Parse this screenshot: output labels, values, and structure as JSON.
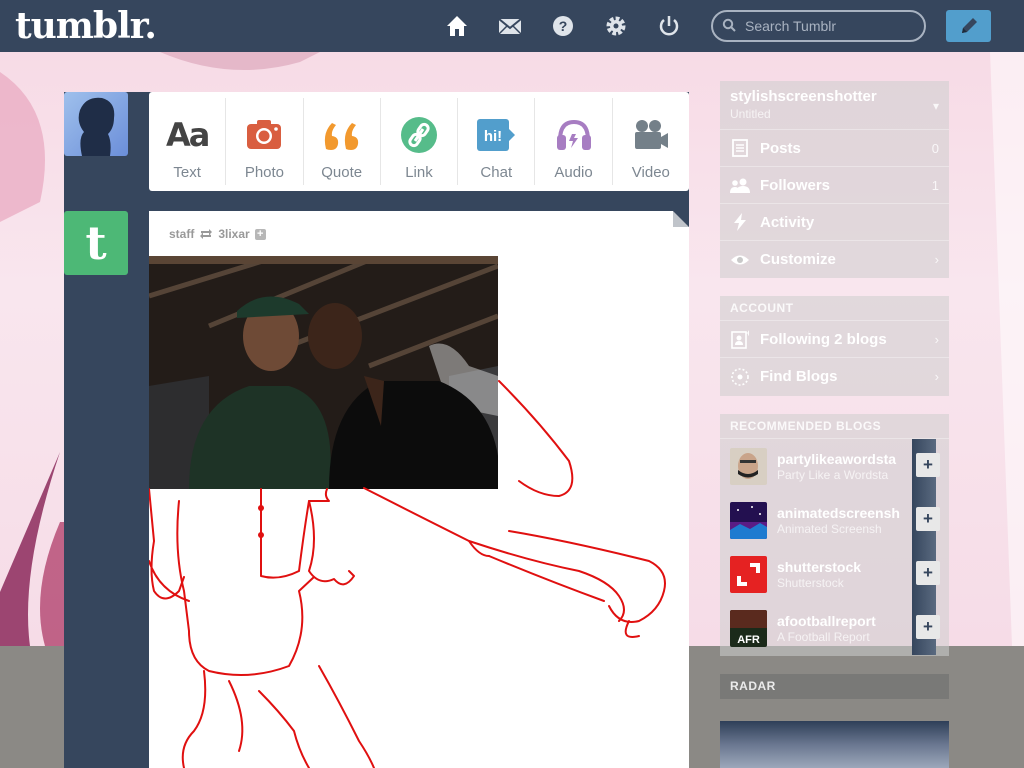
{
  "header": {
    "logo": "tumblr.",
    "search_placeholder": "Search Tumblr",
    "icons": [
      "home-icon",
      "mail-icon",
      "help-icon",
      "gear-icon",
      "power-icon"
    ]
  },
  "post_types": [
    {
      "label": "Text",
      "icon": "text-icon",
      "color": "#444444"
    },
    {
      "label": "Photo",
      "icon": "camera-icon",
      "color": "#d95e40"
    },
    {
      "label": "Quote",
      "icon": "quote-icon",
      "color": "#f2992e"
    },
    {
      "label": "Link",
      "icon": "link-icon",
      "color": "#56bc8a"
    },
    {
      "label": "Chat",
      "icon": "chat-icon",
      "color": "#529ecc"
    },
    {
      "label": "Audio",
      "icon": "headphones-icon",
      "color": "#a77dc2"
    },
    {
      "label": "Video",
      "icon": "video-camera-icon",
      "color": "#748089"
    }
  ],
  "post": {
    "author": "staff",
    "reblogged_from": "3lixar"
  },
  "sidebar": {
    "blog_name": "stylishscreenshotter",
    "blog_subtitle": "Untitled",
    "rows": [
      {
        "label": "Posts",
        "count": "0"
      },
      {
        "label": "Followers",
        "count": "1"
      },
      {
        "label": "Activity",
        "count": ""
      },
      {
        "label": "Customize",
        "count": "›"
      }
    ],
    "account_title": "ACCOUNT",
    "account_rows": [
      {
        "label": "Following 2 blogs"
      },
      {
        "label": "Find Blogs"
      }
    ],
    "recommended_title": "RECOMMENDED BLOGS",
    "recommended": [
      {
        "name": "partylikeawordsta",
        "sub": "Party Like a Wordsta"
      },
      {
        "name": "animatedscreensh",
        "sub": "Animated Screensh"
      },
      {
        "name": "shutterstock",
        "sub": "Shutterstock"
      },
      {
        "name": "afootballreport",
        "sub": "A Football Report",
        "avatar_text": "AFR"
      }
    ],
    "radar_title": "RADAR"
  },
  "colors": {
    "nav": "#36465d",
    "accent": "#529ecc",
    "drawing": "#e01010"
  }
}
